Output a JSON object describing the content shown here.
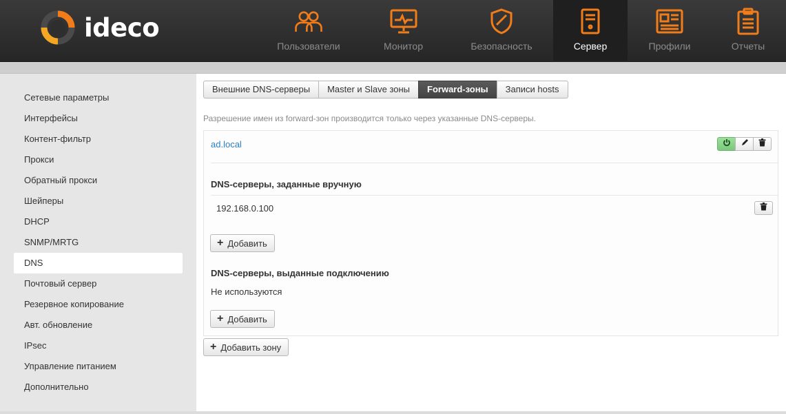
{
  "brand": {
    "name": "ideco"
  },
  "nav": [
    {
      "label": "Пользователи",
      "icon": "users-icon",
      "active": false
    },
    {
      "label": "Монитор",
      "icon": "monitor-icon",
      "active": false
    },
    {
      "label": "Безопасность",
      "icon": "shield-icon",
      "active": false
    },
    {
      "label": "Сервер",
      "icon": "server-icon",
      "active": true
    },
    {
      "label": "Профили",
      "icon": "profile-icon",
      "active": false
    },
    {
      "label": "Отчеты",
      "icon": "clipboard-icon",
      "active": false
    }
  ],
  "sidebar": {
    "items": [
      {
        "label": "Сетевые параметры"
      },
      {
        "label": "Интерфейсы"
      },
      {
        "label": "Контент-фильтр"
      },
      {
        "label": "Прокси"
      },
      {
        "label": "Обратный прокси"
      },
      {
        "label": "Шейперы"
      },
      {
        "label": "DHCP"
      },
      {
        "label": "SNMP/MRTG"
      },
      {
        "label": "DNS",
        "active": true
      },
      {
        "label": "Почтовый сервер"
      },
      {
        "label": "Резервное копирование"
      },
      {
        "label": "Авт. обновление"
      },
      {
        "label": "IPsec"
      },
      {
        "label": "Управление питанием"
      },
      {
        "label": "Дополнительно"
      }
    ]
  },
  "tabs": [
    {
      "label": "Внешние DNS-серверы"
    },
    {
      "label": "Master и Slave зоны"
    },
    {
      "label": "Forward-зоны",
      "active": true
    },
    {
      "label": "Записи hosts"
    }
  ],
  "main": {
    "hint": "Разрешение имен из forward-зон производится только через указанные DNS-серверы.",
    "zone": {
      "name": "ad.local",
      "manual_title": "DNS-серверы, заданные вручную",
      "manual_servers": [
        "192.168.0.100"
      ],
      "add_label": "Добавить",
      "conn_title": "DNS-серверы, выданные подключению",
      "conn_text": "Не используются",
      "add_label2": "Добавить"
    },
    "add_zone_label": "Добавить зону"
  },
  "colors": {
    "accent_orange": "#f07d1a",
    "link_blue": "#2a7fc0",
    "power_green": "#7cc87c"
  }
}
